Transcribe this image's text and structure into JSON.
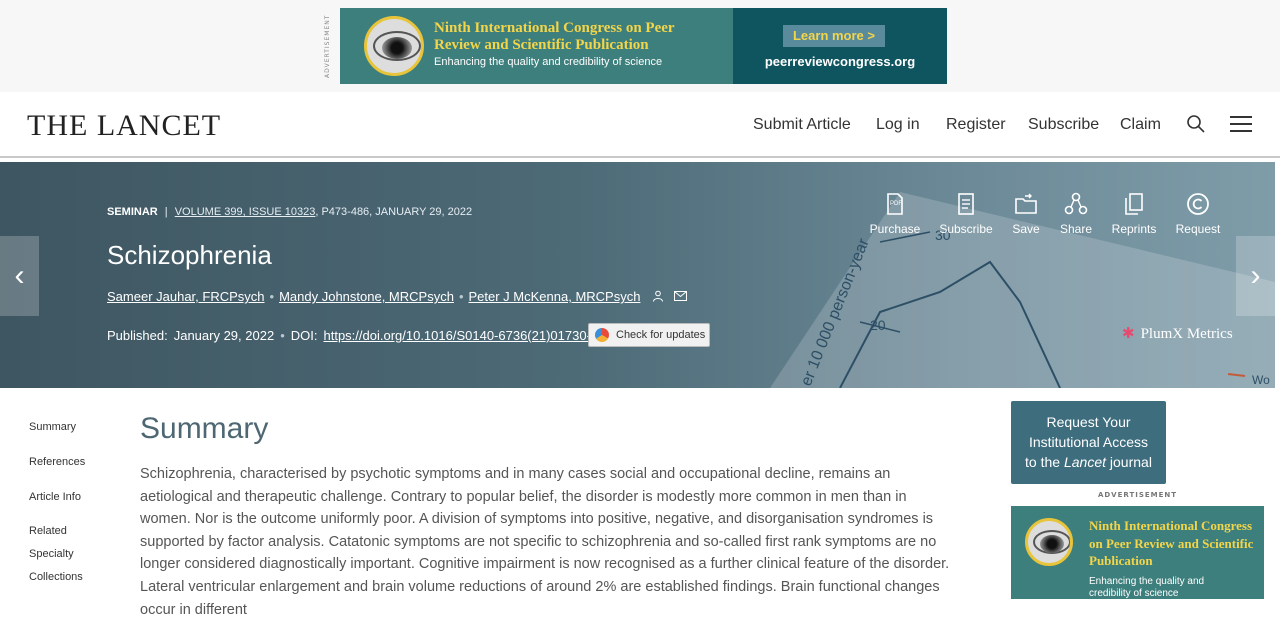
{
  "top_ad": {
    "side_label": "ADVERTISEMENT",
    "headline": "Ninth International Congress on Peer Review and Scientific Publication",
    "subline": "Enhancing the quality and credibility of science",
    "cta": "Learn more >",
    "url": "peerreviewcongress.org"
  },
  "header": {
    "logo": "THE LANCET",
    "nav": [
      "Submit Article",
      "Log in",
      "Register",
      "Subscribe",
      "Claim"
    ]
  },
  "article": {
    "type": "SEMINAR",
    "volume": "VOLUME 399, ISSUE 10323",
    "pages_date": ", P473-486, JANUARY 29, 2022",
    "title": "Schizophrenia",
    "authors": [
      "Sameer Jauhar, FRCPsych",
      "Mandy Johnstone, MRCPsych",
      "Peter J McKenna, MRCPsych"
    ],
    "published_label": "Published:",
    "published_date": "January 29, 2022",
    "doi_label": "DOI:",
    "doi": "https://doi.org/10.1016/S0140-6736(21)01730-X",
    "check_updates": "Check for updates"
  },
  "tools": [
    "Purchase",
    "Subscribe",
    "Save",
    "Share",
    "Reprints",
    "Request"
  ],
  "plumx": "PlumX Metrics",
  "hero_deco": {
    "chart_text": "er 10 000 person-year",
    "t30": "30",
    "t20": "20",
    "wo": "Wo"
  },
  "toc": [
    "Summary",
    "References",
    "Article Info",
    "Related",
    "Specialty",
    "Collections"
  ],
  "summary": {
    "heading": "Summary",
    "text": "Schizophrenia, characterised by psychotic symptoms and in many cases social and occupational decline, remains an aetiological and therapeutic challenge. Contrary to popular belief, the disorder is modestly more common in men than in women. Nor is the outcome uniformly poor. A division of symptoms into positive, negative, and disorganisation syndromes is supported by factor analysis. Catatonic symptoms are not specific to schizophrenia and so-called first rank symptoms are no longer considered diagnostically important. Cognitive impairment is now recognised as a further clinical feature of the disorder. Lateral ventricular enlargement and brain volume reductions of around 2% are established findings. Brain functional changes occur in different"
  },
  "institution": {
    "line1": "Request Your",
    "line2": "Institutional Access",
    "line3_prefix": "to the ",
    "line3_em": "Lancet",
    "line3_suffix": " journal"
  },
  "side_ad": {
    "label": "ADVERTISEMENT",
    "headline": "Ninth International Congress on Peer Review and Scientific Publication",
    "subline": "Enhancing the quality and credibility of science"
  }
}
